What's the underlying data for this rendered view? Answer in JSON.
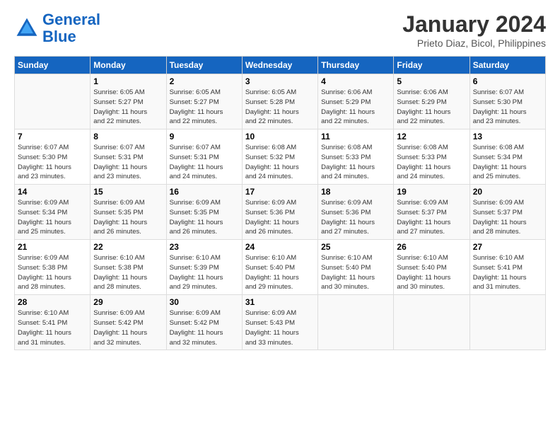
{
  "header": {
    "logo_line1": "General",
    "logo_line2": "Blue",
    "month": "January 2024",
    "location": "Prieto Diaz, Bicol, Philippines"
  },
  "weekdays": [
    "Sunday",
    "Monday",
    "Tuesday",
    "Wednesday",
    "Thursday",
    "Friday",
    "Saturday"
  ],
  "weeks": [
    [
      {
        "day": "",
        "info": ""
      },
      {
        "day": "1",
        "info": "Sunrise: 6:05 AM\nSunset: 5:27 PM\nDaylight: 11 hours\nand 22 minutes."
      },
      {
        "day": "2",
        "info": "Sunrise: 6:05 AM\nSunset: 5:27 PM\nDaylight: 11 hours\nand 22 minutes."
      },
      {
        "day": "3",
        "info": "Sunrise: 6:05 AM\nSunset: 5:28 PM\nDaylight: 11 hours\nand 22 minutes."
      },
      {
        "day": "4",
        "info": "Sunrise: 6:06 AM\nSunset: 5:29 PM\nDaylight: 11 hours\nand 22 minutes."
      },
      {
        "day": "5",
        "info": "Sunrise: 6:06 AM\nSunset: 5:29 PM\nDaylight: 11 hours\nand 22 minutes."
      },
      {
        "day": "6",
        "info": "Sunrise: 6:07 AM\nSunset: 5:30 PM\nDaylight: 11 hours\nand 23 minutes."
      }
    ],
    [
      {
        "day": "7",
        "info": "Sunrise: 6:07 AM\nSunset: 5:30 PM\nDaylight: 11 hours\nand 23 minutes."
      },
      {
        "day": "8",
        "info": "Sunrise: 6:07 AM\nSunset: 5:31 PM\nDaylight: 11 hours\nand 23 minutes."
      },
      {
        "day": "9",
        "info": "Sunrise: 6:07 AM\nSunset: 5:31 PM\nDaylight: 11 hours\nand 24 minutes."
      },
      {
        "day": "10",
        "info": "Sunrise: 6:08 AM\nSunset: 5:32 PM\nDaylight: 11 hours\nand 24 minutes."
      },
      {
        "day": "11",
        "info": "Sunrise: 6:08 AM\nSunset: 5:33 PM\nDaylight: 11 hours\nand 24 minutes."
      },
      {
        "day": "12",
        "info": "Sunrise: 6:08 AM\nSunset: 5:33 PM\nDaylight: 11 hours\nand 24 minutes."
      },
      {
        "day": "13",
        "info": "Sunrise: 6:08 AM\nSunset: 5:34 PM\nDaylight: 11 hours\nand 25 minutes."
      }
    ],
    [
      {
        "day": "14",
        "info": "Sunrise: 6:09 AM\nSunset: 5:34 PM\nDaylight: 11 hours\nand 25 minutes."
      },
      {
        "day": "15",
        "info": "Sunrise: 6:09 AM\nSunset: 5:35 PM\nDaylight: 11 hours\nand 26 minutes."
      },
      {
        "day": "16",
        "info": "Sunrise: 6:09 AM\nSunset: 5:35 PM\nDaylight: 11 hours\nand 26 minutes."
      },
      {
        "day": "17",
        "info": "Sunrise: 6:09 AM\nSunset: 5:36 PM\nDaylight: 11 hours\nand 26 minutes."
      },
      {
        "day": "18",
        "info": "Sunrise: 6:09 AM\nSunset: 5:36 PM\nDaylight: 11 hours\nand 27 minutes."
      },
      {
        "day": "19",
        "info": "Sunrise: 6:09 AM\nSunset: 5:37 PM\nDaylight: 11 hours\nand 27 minutes."
      },
      {
        "day": "20",
        "info": "Sunrise: 6:09 AM\nSunset: 5:37 PM\nDaylight: 11 hours\nand 28 minutes."
      }
    ],
    [
      {
        "day": "21",
        "info": "Sunrise: 6:09 AM\nSunset: 5:38 PM\nDaylight: 11 hours\nand 28 minutes."
      },
      {
        "day": "22",
        "info": "Sunrise: 6:10 AM\nSunset: 5:38 PM\nDaylight: 11 hours\nand 28 minutes."
      },
      {
        "day": "23",
        "info": "Sunrise: 6:10 AM\nSunset: 5:39 PM\nDaylight: 11 hours\nand 29 minutes."
      },
      {
        "day": "24",
        "info": "Sunrise: 6:10 AM\nSunset: 5:40 PM\nDaylight: 11 hours\nand 29 minutes."
      },
      {
        "day": "25",
        "info": "Sunrise: 6:10 AM\nSunset: 5:40 PM\nDaylight: 11 hours\nand 30 minutes."
      },
      {
        "day": "26",
        "info": "Sunrise: 6:10 AM\nSunset: 5:40 PM\nDaylight: 11 hours\nand 30 minutes."
      },
      {
        "day": "27",
        "info": "Sunrise: 6:10 AM\nSunset: 5:41 PM\nDaylight: 11 hours\nand 31 minutes."
      }
    ],
    [
      {
        "day": "28",
        "info": "Sunrise: 6:10 AM\nSunset: 5:41 PM\nDaylight: 11 hours\nand 31 minutes."
      },
      {
        "day": "29",
        "info": "Sunrise: 6:09 AM\nSunset: 5:42 PM\nDaylight: 11 hours\nand 32 minutes."
      },
      {
        "day": "30",
        "info": "Sunrise: 6:09 AM\nSunset: 5:42 PM\nDaylight: 11 hours\nand 32 minutes."
      },
      {
        "day": "31",
        "info": "Sunrise: 6:09 AM\nSunset: 5:43 PM\nDaylight: 11 hours\nand 33 minutes."
      },
      {
        "day": "",
        "info": ""
      },
      {
        "day": "",
        "info": ""
      },
      {
        "day": "",
        "info": ""
      }
    ]
  ]
}
